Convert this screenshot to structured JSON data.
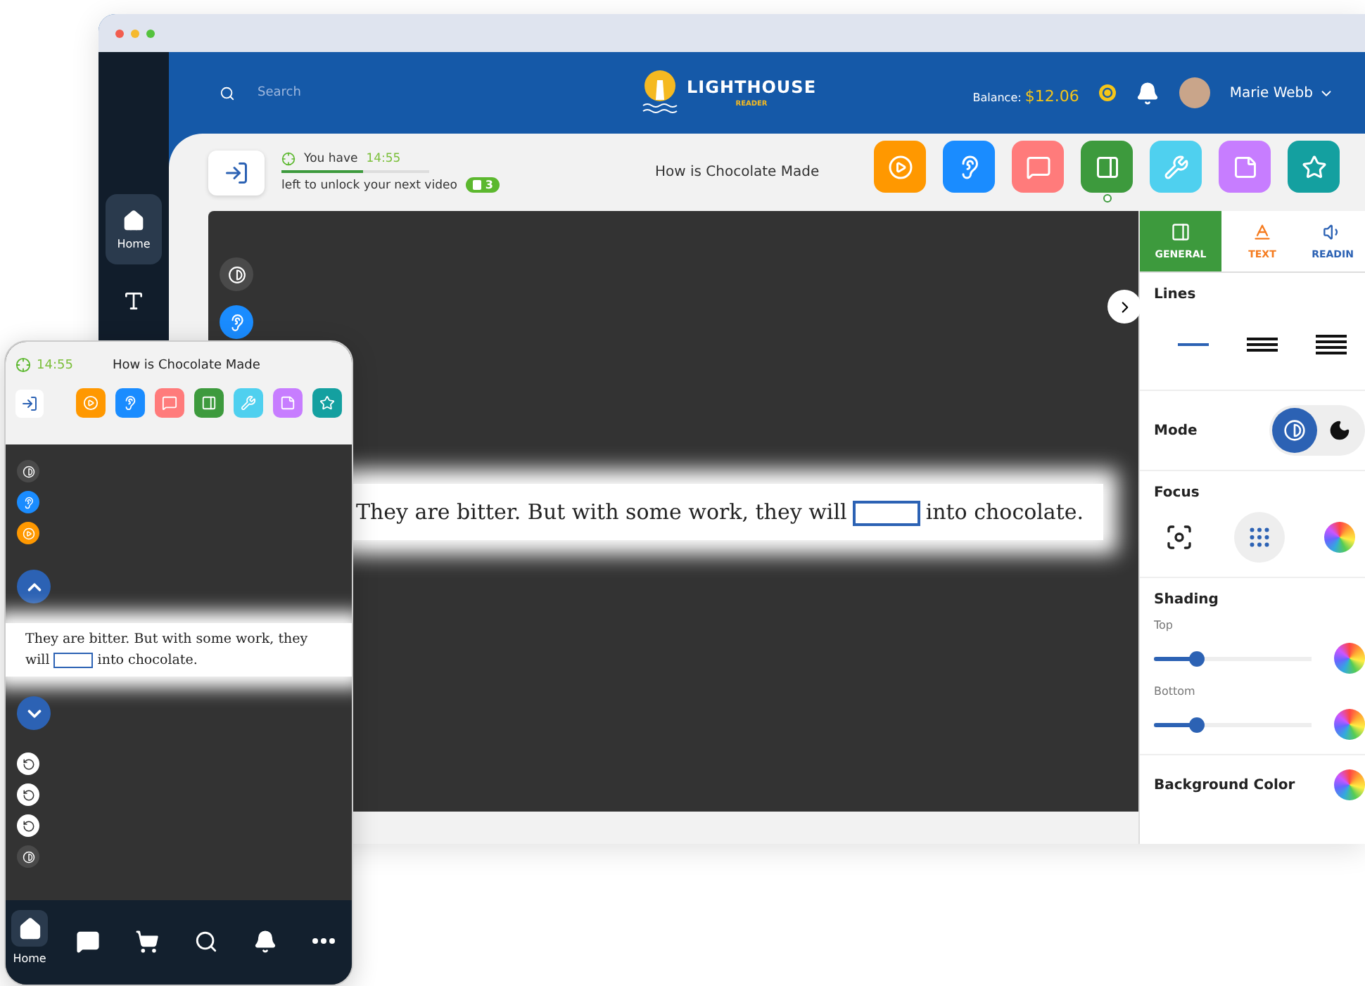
{
  "desktop": {
    "sidebar": {
      "items": [
        {
          "label": "Home",
          "selected": true
        }
      ]
    },
    "header": {
      "search": {
        "placeholder": "Search"
      },
      "logo": {
        "name": "LIGHTHOUSE",
        "tagline": "READER"
      },
      "balance": {
        "label": "Balance:",
        "value": "$12.06"
      },
      "user": {
        "name": "Marie Webb"
      }
    },
    "toolbar": {
      "timer": {
        "prefix": "You have",
        "time": "14:55",
        "caption": "left to unlock your next video",
        "level": 0.55,
        "badge": "3"
      },
      "title": "How is Chocolate Made",
      "tools": [
        {
          "kind": "play",
          "color": "#ff9800",
          "selected": false
        },
        {
          "kind": "ear",
          "color": "#1a8cff",
          "selected": false
        },
        {
          "kind": "chat",
          "color": "#ff7b7b",
          "selected": false
        },
        {
          "kind": "book",
          "color": "#3d9a3d",
          "selected": true
        },
        {
          "kind": "wrench",
          "color": "#4fd0ef",
          "selected": false
        },
        {
          "kind": "tag",
          "color": "#c77dff",
          "selected": false
        },
        {
          "kind": "star",
          "color": "#14a0a0",
          "selected": false
        }
      ]
    },
    "reader": {
      "side_buttons": [
        {
          "kind": "contrast"
        },
        {
          "kind": "ear"
        }
      ],
      "sentence": {
        "before": "They are bitter. But with some work, they will",
        "after": "into chocolate."
      }
    },
    "settings": {
      "tabs": [
        {
          "label": "GENERAL",
          "kind": "general",
          "selected": true
        },
        {
          "label": "TEXT",
          "kind": "text",
          "selected": false
        },
        {
          "label": "READIN",
          "kind": "reading",
          "selected": false
        }
      ],
      "lines": {
        "title": "Lines",
        "options": [
          {
            "selected": true
          },
          {
            "selected": false
          },
          {
            "selected": false
          }
        ]
      },
      "mode": {
        "title": "Mode",
        "dark": false
      },
      "focus": {
        "title": "Focus",
        "options": [
          {
            "kind": "frame",
            "selected": false
          },
          {
            "kind": "dots",
            "selected": true
          },
          {
            "kind": "color",
            "selected": false
          }
        ]
      },
      "shading": {
        "title": "Shading",
        "sliders": [
          {
            "label": "Top",
            "level": 0.27
          },
          {
            "label": "Bottom",
            "level": 0.27
          }
        ]
      },
      "background_color": {
        "title": "Background Color"
      }
    }
  },
  "phone": {
    "time": "14:55",
    "title": "How is Chocolate Made",
    "tools": [
      {
        "kind": "play",
        "color": "#ff9800"
      },
      {
        "kind": "ear",
        "color": "#1a8cff"
      },
      {
        "kind": "chat",
        "color": "#ff7b7b"
      },
      {
        "kind": "book",
        "color": "#3d9a3d"
      },
      {
        "kind": "wrench",
        "color": "#4fd0ef"
      },
      {
        "kind": "tag",
        "color": "#c77dff"
      },
      {
        "kind": "star",
        "color": "#14a0a0"
      }
    ],
    "side_buttons": [
      {
        "kind": "contrast"
      },
      {
        "kind": "ear"
      },
      {
        "kind": "play"
      }
    ],
    "sentence": {
      "before": "They are bitter. But with some work, they will",
      "after": "into chocolate."
    },
    "replay_buttons": [
      {
        "kind": "replay"
      },
      {
        "kind": "replay"
      },
      {
        "kind": "replay"
      },
      {
        "kind": "contrast"
      }
    ],
    "nav": [
      {
        "kind": "home",
        "label": "Home",
        "selected": true
      },
      {
        "kind": "chat",
        "selected": false
      },
      {
        "kind": "cart",
        "selected": false
      },
      {
        "kind": "search",
        "selected": false
      },
      {
        "kind": "bell",
        "selected": false
      },
      {
        "kind": "more",
        "selected": false
      }
    ]
  }
}
